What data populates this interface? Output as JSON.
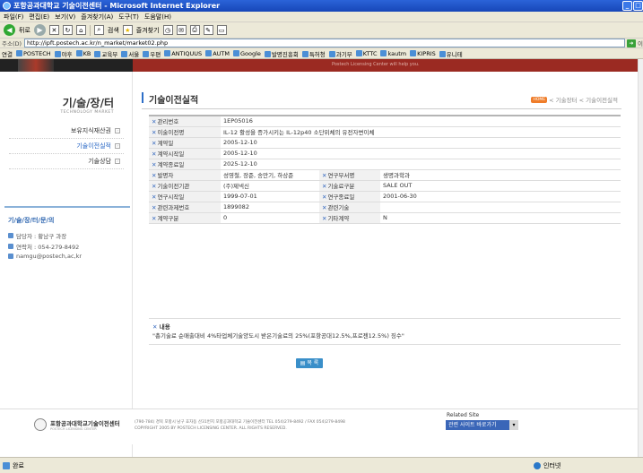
{
  "window": {
    "title": "포항공과대학교 기술이전센터 - Microsoft Internet Explorer"
  },
  "menu": [
    "파일(F)",
    "편집(E)",
    "보기(V)",
    "즐겨찾기(A)",
    "도구(T)",
    "도움말(H)"
  ],
  "toolbar": {
    "back_label": "뒤로",
    "search_label": "검색",
    "favorites_label": "즐겨찾기"
  },
  "address": {
    "label": "주소(D)",
    "url": "http://ipft.postech.ac.kr/n_market/market02.php",
    "go_label": "이"
  },
  "links": {
    "label": "연결",
    "items": [
      "POSTECH",
      "야후",
      "KB",
      "교육부",
      "서울",
      "우편",
      "ANTIQUUS",
      "AUTM",
      "Google",
      "발명진흥회",
      "특허청",
      "과기부",
      "KTTC",
      "kautm",
      "KIPRIS",
      "유니테"
    ]
  },
  "banner": {
    "tagline": "Postech Licensing Center will help you."
  },
  "sidebar": {
    "title": "기/술/장/터",
    "subtitle": "TECHNOLOGY MARKET",
    "items": [
      {
        "label": "보유지식재산권"
      },
      {
        "label": "기술이전실적"
      },
      {
        "label": "기술상담"
      }
    ],
    "contact": {
      "title": "기/술/장/터/문/의",
      "person": "담당자 : 황남구 과장",
      "phone": "연락처 : 054-279-8492",
      "email": "namgu@postech,ac,kr"
    }
  },
  "header": {
    "title": "기술이전실적",
    "home_badge": "HOME",
    "breadcrumb": "< 기술장터 < 기술이전실적"
  },
  "record": {
    "mgmt_no_label": "관리번호",
    "mgmt_no": "1EP05016",
    "tech_name_label": "이술이전명",
    "tech_name": "IL-12 활성을 증가시키는 IL-12p40 소단위체의 유전자변이체",
    "contract_date_label": "계약일",
    "contract_date": "2005-12-10",
    "start_date_label": "계약시작일",
    "start_date": "2005-12-10",
    "end_date_label": "계약종료일",
    "end_date": "2025-12-10",
    "inventor_label": "발명자",
    "inventor": "성영철, 장준, 송만기, 하상준",
    "dept_label": "연구부서명",
    "dept": "생명과학과",
    "recipient_label": "기술이전기관",
    "recipient": "(주)제넥신",
    "fee_type_label": "기술료구분",
    "fee_type": "SALE OUT",
    "research_start_label": "연구시작일",
    "research_start": "1999-07-01",
    "research_end_label": "연구종료일",
    "research_end": "2001-06-30",
    "project_no_label": "관련과제번호",
    "project_no": "1899082",
    "related_tech_label": "관련기술",
    "related_tech": "",
    "contract_type_label": "계약구분",
    "contract_type": "0",
    "other_contract_label": "기타계약",
    "other_contract": "N",
    "content_label": "내용",
    "content": "\"총기술료 순매출대비 4%타업체기술양도시 받은기술료의 25%(포항공대12.5%,프로젠12.5%) 징수\""
  },
  "list_button": "목 록",
  "footer": {
    "logo_name": "포항공과대학교기술이전센터",
    "logo_sub": "POSTECH LICENSING CENTER",
    "address": "(790-784) 경북 포항시 남구 효자동 산31번지 포항공과대학교 기술이전센터   TEL 054)279-8492 / FAX 054)279-8498",
    "copyright": "COPYRIGHT 2005 BY POSTECH LICENSING CENTER. ALL RIGHTS RESERVED.",
    "related_label": "Related Site",
    "related_select": "관련 사이트 바로가기"
  },
  "status": {
    "left": "완료",
    "right": "인터넷"
  }
}
